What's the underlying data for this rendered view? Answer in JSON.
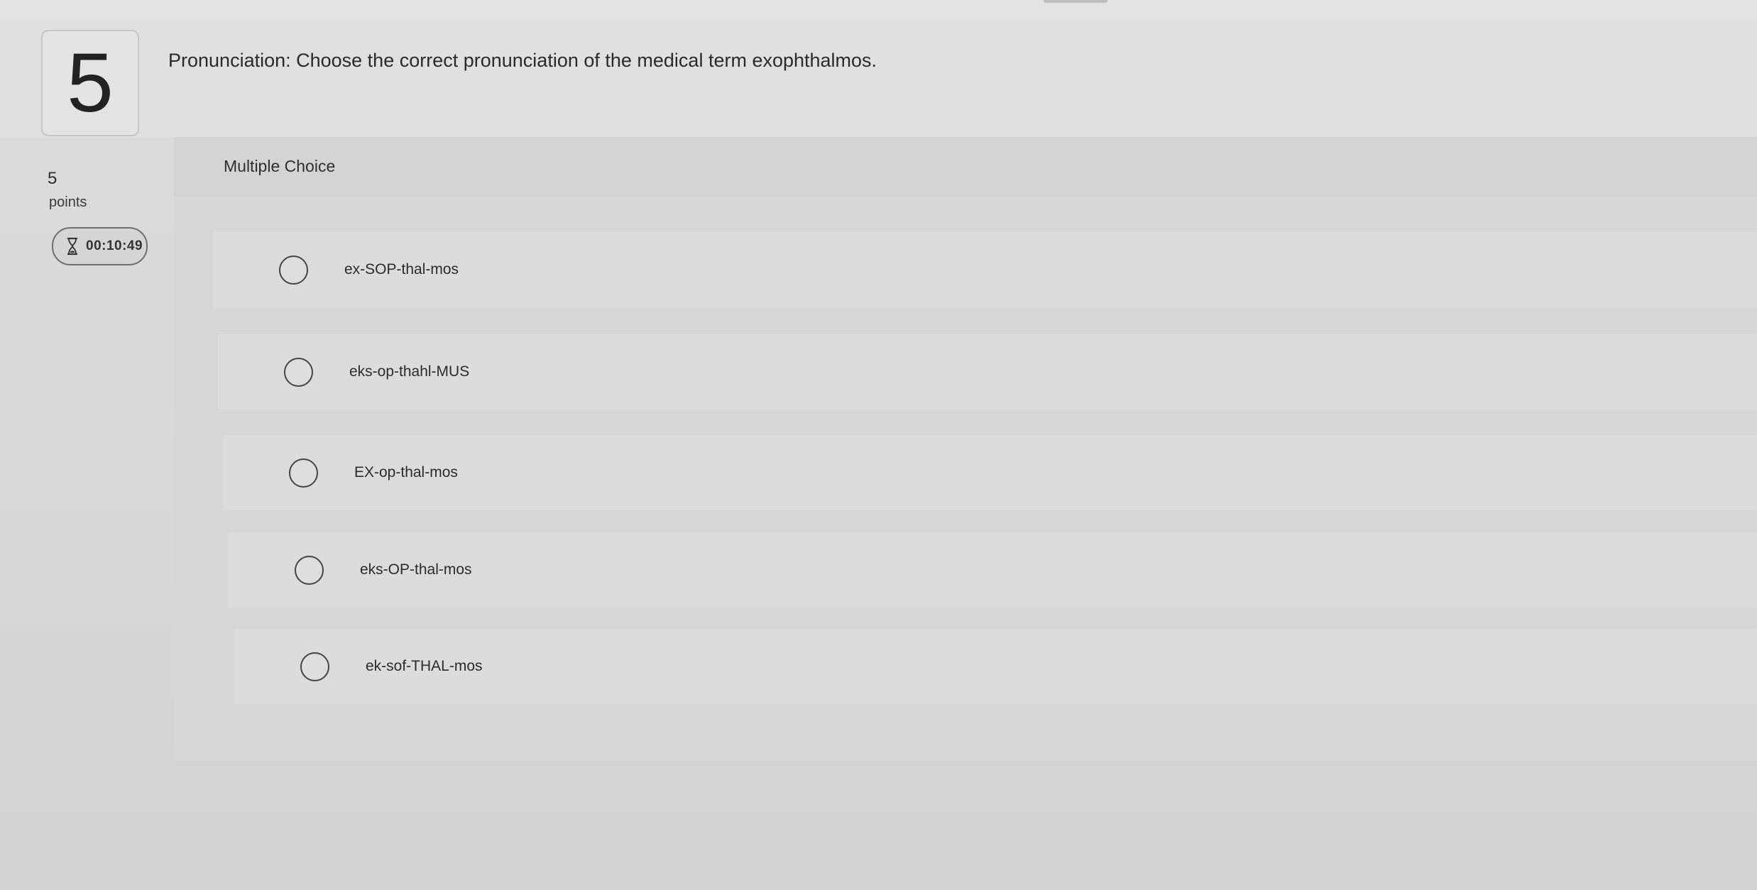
{
  "question": {
    "number": "5",
    "text": "Pronunciation: Choose the correct pronunciation of the medical term exophthalmos."
  },
  "points": {
    "value": "5",
    "label": "points"
  },
  "timer": {
    "icon": "hourglass-icon",
    "value": "00:10:49"
  },
  "choice_panel": {
    "label": "Multiple Choice",
    "options": [
      {
        "label": "ex-SOP-thal-mos",
        "selected": false
      },
      {
        "label": "eks-op-thahl-MUS",
        "selected": false
      },
      {
        "label": "EX-op-thal-mos",
        "selected": false
      },
      {
        "label": "eks-OP-thal-mos",
        "selected": false
      },
      {
        "label": "ek-sof-THAL-mos",
        "selected": false
      }
    ]
  }
}
